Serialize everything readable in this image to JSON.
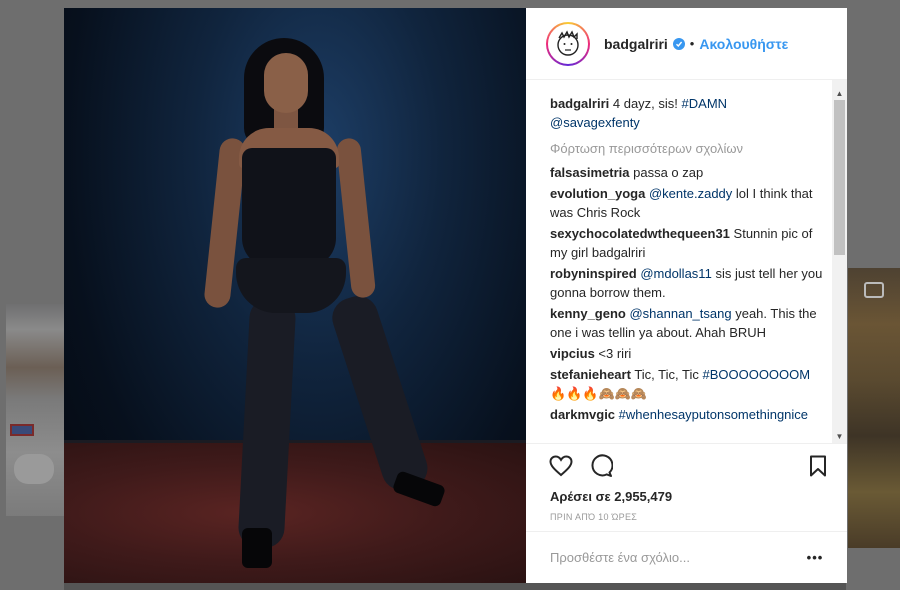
{
  "post": {
    "username": "badgalriri",
    "follow_label": "Ακολουθήστε",
    "separator": "•",
    "caption": {
      "user": "badgalriri",
      "text": "4 dayz, sis!",
      "hashtag": "#DAMN",
      "mention": "@savagexfenty"
    },
    "load_more_label": "Φόρτωση περισσότερων σχολίων",
    "comments": [
      {
        "user": "falsasimetria",
        "parts": [
          {
            "t": "text",
            "v": "passa o zap"
          }
        ]
      },
      {
        "user": "evolution_yoga",
        "parts": [
          {
            "t": "link",
            "v": "@kente.zaddy"
          },
          {
            "t": "text",
            "v": "lol I think that was Chris Rock"
          }
        ]
      },
      {
        "user": "sexychocolatedwthequeen31",
        "parts": [
          {
            "t": "text",
            "v": "Stunnin pic of my girl badgalriri"
          }
        ]
      },
      {
        "user": "robyninspired",
        "parts": [
          {
            "t": "link",
            "v": "@mdollas11"
          },
          {
            "t": "text",
            "v": "sis just tell her you gonna borrow them."
          }
        ]
      },
      {
        "user": "kenny_geno",
        "parts": [
          {
            "t": "link",
            "v": "@shannan_tsang"
          },
          {
            "t": "text",
            "v": "yeah. This the one i was tellin ya about. Ahah BRUH"
          }
        ]
      },
      {
        "user": "vipcius",
        "parts": [
          {
            "t": "text",
            "v": "<3 riri"
          }
        ]
      },
      {
        "user": "stefanieheart",
        "parts": [
          {
            "t": "text",
            "v": "Tic, Tic, Tic"
          },
          {
            "t": "link",
            "v": "#BOOOOOOOOM"
          },
          {
            "t": "text",
            "v": "🔥🔥🔥🙈🙈🙈"
          }
        ]
      },
      {
        "user": "darkmvgic",
        "parts": [
          {
            "t": "link",
            "v": "#whenhesayputonsomethingnice"
          }
        ]
      }
    ],
    "likes_label": "Αρέσει σε 2,955,479",
    "timestamp": "ΠΡΙΝ ΑΠΌ 10 ΏΡΕΣ",
    "comment_placeholder": "Προσθέστε ένα σχόλιο...",
    "more_label": "•••"
  },
  "icons": {
    "verified": "verified-badge-icon",
    "like": "heart-icon",
    "comment": "speech-bubble-icon",
    "save": "bookmark-icon",
    "bg_camera": "video-camera-icon"
  },
  "colors": {
    "link": "#003569",
    "follow": "#3897f0",
    "muted": "#999999"
  }
}
